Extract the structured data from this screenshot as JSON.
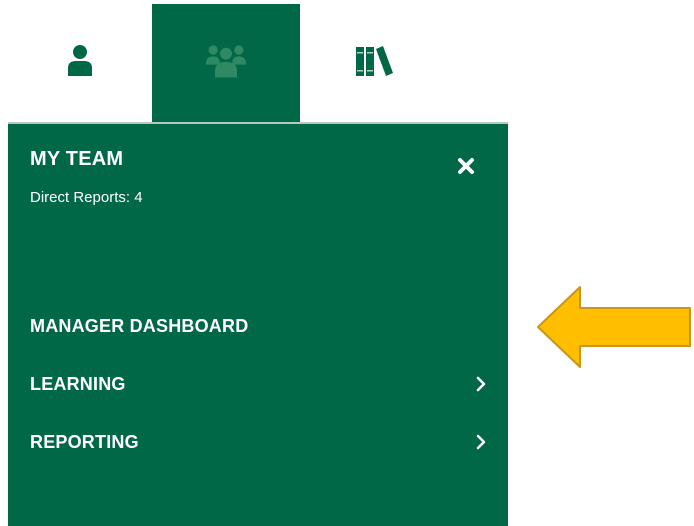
{
  "colors": {
    "brand_green": "#006747",
    "highlight_arrow": "#FFBF00",
    "arrow_outline": "#C8961A"
  },
  "tabs": [
    {
      "name": "profile",
      "icon": "user-icon",
      "active": false
    },
    {
      "name": "team",
      "icon": "team-icon",
      "active": true
    },
    {
      "name": "library",
      "icon": "books-icon",
      "active": false
    }
  ],
  "panel": {
    "title": "MY TEAM",
    "subtitle": "Direct Reports: 4",
    "close_icon": "close-icon",
    "menu": [
      {
        "label": "MANAGER DASHBOARD",
        "has_submenu": false
      },
      {
        "label": "LEARNING",
        "has_submenu": true,
        "icon": "chevron-right-icon"
      },
      {
        "label": "REPORTING",
        "has_submenu": true,
        "icon": "chevron-right-icon"
      }
    ]
  },
  "annotation": {
    "icon": "arrow-left-icon"
  }
}
